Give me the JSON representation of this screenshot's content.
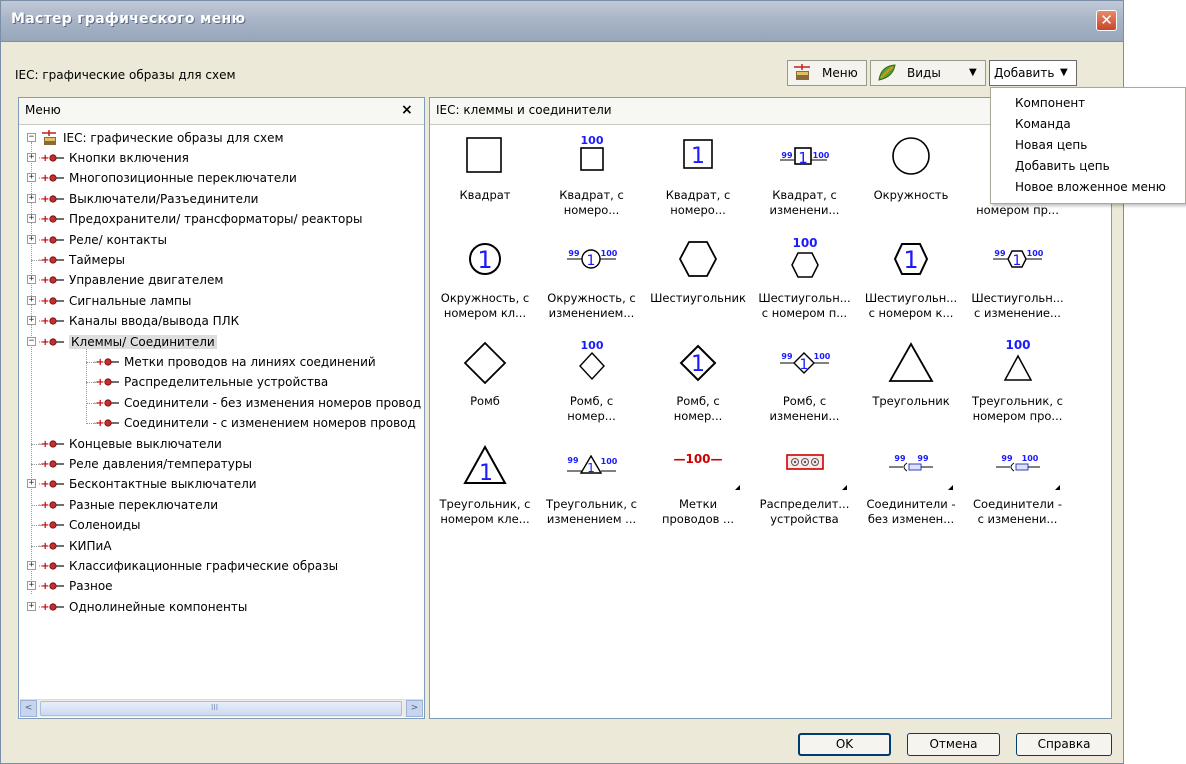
{
  "window": {
    "title": "Мастер графического меню"
  },
  "subtitle": "IEC: графические образы для схем",
  "toolbar": {
    "menu_label": "Меню",
    "views_label": "Виды",
    "add_label": "Добавить"
  },
  "left_pane": {
    "header": "Меню",
    "close_glyph": "×",
    "root": "IEC: графические образы для схем",
    "items": [
      {
        "label": "Кнопки включения",
        "expander": "+"
      },
      {
        "label": "Многопозиционные переключатели",
        "expander": "+"
      },
      {
        "label": "Выключатели/Разъединители",
        "expander": "+"
      },
      {
        "label": "Предохранители/ трансформаторы/ реакторы",
        "expander": "+"
      },
      {
        "label": "Реле/ контакты",
        "expander": "+"
      },
      {
        "label": "Таймеры",
        "expander": ""
      },
      {
        "label": "Управление двигателем",
        "expander": "+"
      },
      {
        "label": "Сигнальные лампы",
        "expander": "+"
      },
      {
        "label": "Каналы ввода/вывода ПЛК",
        "expander": "+"
      },
      {
        "label": "Клеммы/ Соединители",
        "expander": "−",
        "selected": true
      },
      {
        "label": "Метки проводов на линиях соединений",
        "expander": "",
        "child": true
      },
      {
        "label": "Распределительные устройства",
        "expander": "",
        "child": true
      },
      {
        "label": "Соединители - без изменения номеров провод",
        "expander": "",
        "child": true
      },
      {
        "label": "Соединители - с изменением номеров провод",
        "expander": "",
        "child": true
      },
      {
        "label": "Концевые выключатели",
        "expander": ""
      },
      {
        "label": "Реле давления/температуры",
        "expander": ""
      },
      {
        "label": "Бесконтактные выключатели",
        "expander": "+"
      },
      {
        "label": "Разные переключатели",
        "expander": ""
      },
      {
        "label": "Соленоиды",
        "expander": ""
      },
      {
        "label": "КИПиА",
        "expander": ""
      },
      {
        "label": "Классификационные графические образы",
        "expander": "+"
      },
      {
        "label": "Разное",
        "expander": "+"
      },
      {
        "label": "Однолинейные компоненты",
        "expander": "+"
      }
    ],
    "scroll_left": "<",
    "scroll_right": ">",
    "scroll_grip": "III"
  },
  "right_pane": {
    "header": "IEC: клеммы и соединители",
    "items": [
      {
        "line1": "Квадрат",
        "line2": "",
        "icon": "square-icon"
      },
      {
        "line1": "Квадрат, с",
        "line2": "номеро...",
        "icon": "square-number-icon"
      },
      {
        "line1": "Квадрат, с",
        "line2": "номеро...",
        "icon": "square-inner-number-icon"
      },
      {
        "line1": "Квадрат, с",
        "line2": "изменени...",
        "icon": "square-change-icon"
      },
      {
        "line1": "Окружность",
        "line2": "",
        "icon": "circle-icon"
      },
      {
        "line1": "Окру",
        "line2": "номером пр...",
        "icon": "circle-number-icon"
      },
      {
        "line1": "Окружность, с",
        "line2": "номером кл...",
        "icon": "circle-terminal-icon"
      },
      {
        "line1": "Окружность, с",
        "line2": "изменением...",
        "icon": "circle-change-icon"
      },
      {
        "line1": "Шестиугольник",
        "line2": "",
        "icon": "hexagon-icon"
      },
      {
        "line1": "Шестиугольн...",
        "line2": "с номером п...",
        "icon": "hexagon-number-icon"
      },
      {
        "line1": "Шестиугольн...",
        "line2": "с номером к...",
        "icon": "hexagon-terminal-icon"
      },
      {
        "line1": "Шестиугольн...",
        "line2": "с изменение...",
        "icon": "hexagon-change-icon"
      },
      {
        "line1": "Ромб",
        "line2": "",
        "icon": "diamond-icon"
      },
      {
        "line1": "Ромб, с",
        "line2": "номер...",
        "icon": "diamond-number-icon"
      },
      {
        "line1": "Ромб, с",
        "line2": "номер...",
        "icon": "diamond-terminal-icon"
      },
      {
        "line1": "Ромб, с",
        "line2": "изменени...",
        "icon": "diamond-change-icon"
      },
      {
        "line1": "Треугольник",
        "line2": "",
        "icon": "triangle-icon"
      },
      {
        "line1": "Треугольник, с",
        "line2": "номером про...",
        "icon": "triangle-number-icon"
      },
      {
        "line1": "Треугольник, с",
        "line2": "номером кле...",
        "icon": "triangle-terminal-icon"
      },
      {
        "line1": "Треугольник, с",
        "line2": "изменением ...",
        "icon": "triangle-change-icon"
      },
      {
        "line1": "Метки",
        "line2": "проводов ...",
        "icon": "wire-label-icon"
      },
      {
        "line1": "Распределит...",
        "line2": "устройства",
        "icon": "distribution-icon"
      },
      {
        "line1": "Соединители -",
        "line2": "без изменен...",
        "icon": "connector-same-icon"
      },
      {
        "line1": "Соединители -",
        "line2": "с изменени...",
        "icon": "connector-change-icon"
      }
    ],
    "sym_texts": {
      "n100": "100",
      "n1": "1",
      "n99": "99",
      "wire": "—100—"
    }
  },
  "dropdown": {
    "items": [
      "Компонент",
      "Команда",
      "Новая цепь",
      "Добавить цепь",
      "Новое вложенное меню"
    ]
  },
  "buttons": {
    "ok": "OK",
    "cancel": "Отмена",
    "help": "Справка"
  },
  "colors": {
    "accent_blue": "#1a1aff",
    "selected_bg": "#dedede",
    "red": "#cc0000"
  }
}
